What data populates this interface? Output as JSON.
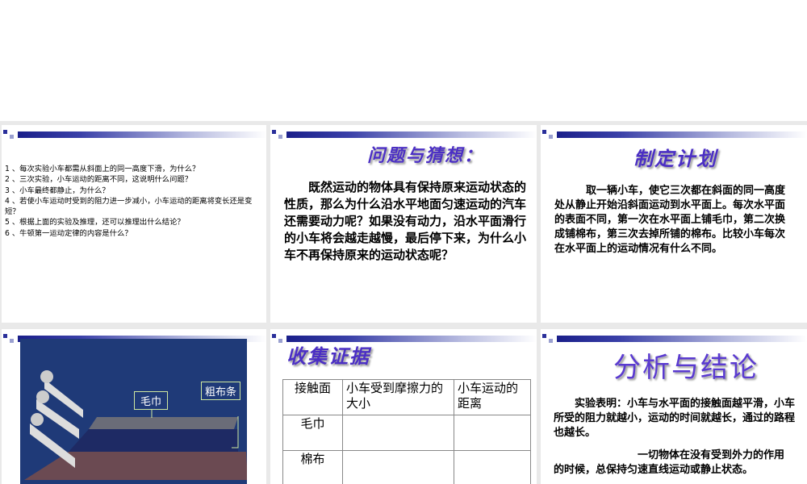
{
  "slides": [
    {
      "questions": [
        "1 、每次实验小车都需从斜面上的同一高度下滑，为什么？",
        "2 、三次实验，小车运动的距离不同，这说明什么问题？",
        "3 、小车最终都静止，为什么？",
        "4 、若使小车运动时受到的阻力进一步减小，小车运动的距离将变长还是变短？",
        "5 、根据上面的实验及推理，还可以推理出什么结论？",
        "6 、牛顿第一运动定律的内容是什么？"
      ]
    },
    {
      "title": "问题与猜想：",
      "body": "　　既然运动的物体具有保持原来运动状态的性质，那么为什么沿水平地面匀速运动的汽车还需要动力呢？如果没有动力，沿水平面滑行的小车将会越走越慢，最后停下来，为什么小车不再保持原来的运动状态呢？"
    },
    {
      "title": "制定计划",
      "body": "　　　取一辆小车，使它三次都在斜面的同一高度处从静止开始沿斜面运动到水平面上。每次水平面的表面不同，第一次在水平面上铺毛巾，第二次换成铺棉布，第三次去掉所铺的棉布。比较小车每次在水平面上的运动情况有什么不同。"
    },
    {
      "labels": {
        "towel": "毛巾",
        "cloth": "粗布条"
      }
    },
    {
      "title": "收集证据",
      "table": {
        "headers": [
          "接触面",
          "小车受到摩擦力的大小",
          "小车运动的距离"
        ],
        "rows": [
          [
            "毛巾",
            "",
            ""
          ],
          [
            "棉布",
            "",
            ""
          ]
        ]
      }
    },
    {
      "title": "分析与结论",
      "body1": "　　实验表明：小车与水平面的接触面越平滑，小车所受的阻力就越小，运动的时间就越长，通过的路程也越长。",
      "body2": "　　　　　　　　一切物体在没有受到外力的作用的时候，总保持匀速直线运动或静止状态。"
    }
  ]
}
